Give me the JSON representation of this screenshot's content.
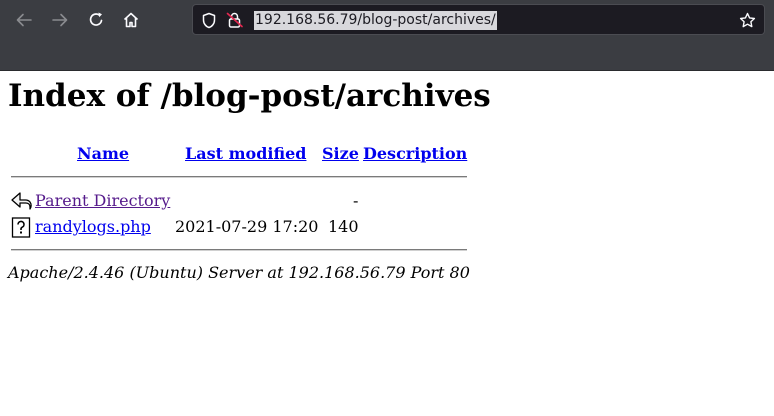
{
  "browser": {
    "url": "192.168.56.79/blog-post/archives/",
    "icons": {
      "back": "arrow-left-icon",
      "forward": "arrow-right-icon",
      "reload": "reload-icon",
      "home": "home-icon",
      "tracking": "shield-icon",
      "insecure": "insecure-lock-icon",
      "bookmark": "star-icon"
    }
  },
  "page": {
    "title": "Index of /blog-post/archives",
    "columns": {
      "name": "Name",
      "last_modified": "Last modified",
      "size": "Size",
      "description": "Description"
    },
    "rows": [
      {
        "icon": "parent-directory-icon",
        "name": "Parent Directory",
        "last_modified": "",
        "size": "-",
        "description": ""
      },
      {
        "icon": "unknown-file-icon",
        "name": "randylogs.php",
        "last_modified": "2021-07-29 17:20",
        "size": "140",
        "description": ""
      }
    ],
    "address": "Apache/2.4.46 (Ubuntu) Server at 192.168.56.79 Port 80"
  },
  "colors": {
    "toolbar": "#3b3d42",
    "urlbar": "#1c1b22",
    "link": "#0000ee",
    "visited_link": "#551a8b"
  }
}
